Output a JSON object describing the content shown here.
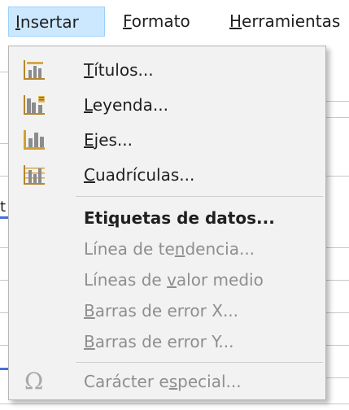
{
  "menubar": {
    "insertar": {
      "pre": "",
      "mn": "I",
      "post": "nsertar"
    },
    "formato": {
      "pre": "",
      "mn": "F",
      "post": "ormato"
    },
    "herramientas": {
      "pre": "",
      "mn": "H",
      "post": "erramientas"
    }
  },
  "background": {
    "cell_fragment": "t"
  },
  "menu": {
    "items": [
      {
        "pre": "",
        "mn": "T",
        "post": "ítulos...",
        "icon": "chart-titles-icon"
      },
      {
        "pre": "",
        "mn": "L",
        "post": "eyenda...",
        "icon": "chart-legend-icon"
      },
      {
        "pre": "",
        "mn": "E",
        "post": "jes...",
        "icon": "chart-axes-icon"
      },
      {
        "pre": "",
        "mn": "C",
        "post": "uadrículas...",
        "icon": "chart-grid-icon"
      },
      {
        "pre": "Eti",
        "mn": "q",
        "post": "uetas de datos..."
      },
      {
        "pre": "Línea de te",
        "mn": "n",
        "post": "dencia..."
      },
      {
        "pre": "Líneas de ",
        "mn": "v",
        "post": "alor medio"
      },
      {
        "pre": "",
        "mn": "B",
        "post": "arras de error X..."
      },
      {
        "pre": "",
        "mn": "B",
        "post": "arras de error Y..."
      },
      {
        "pre": "Carácter e",
        "mn": "s",
        "post": "pecial...",
        "icon": "omega-icon",
        "omega": "Ω"
      }
    ]
  }
}
